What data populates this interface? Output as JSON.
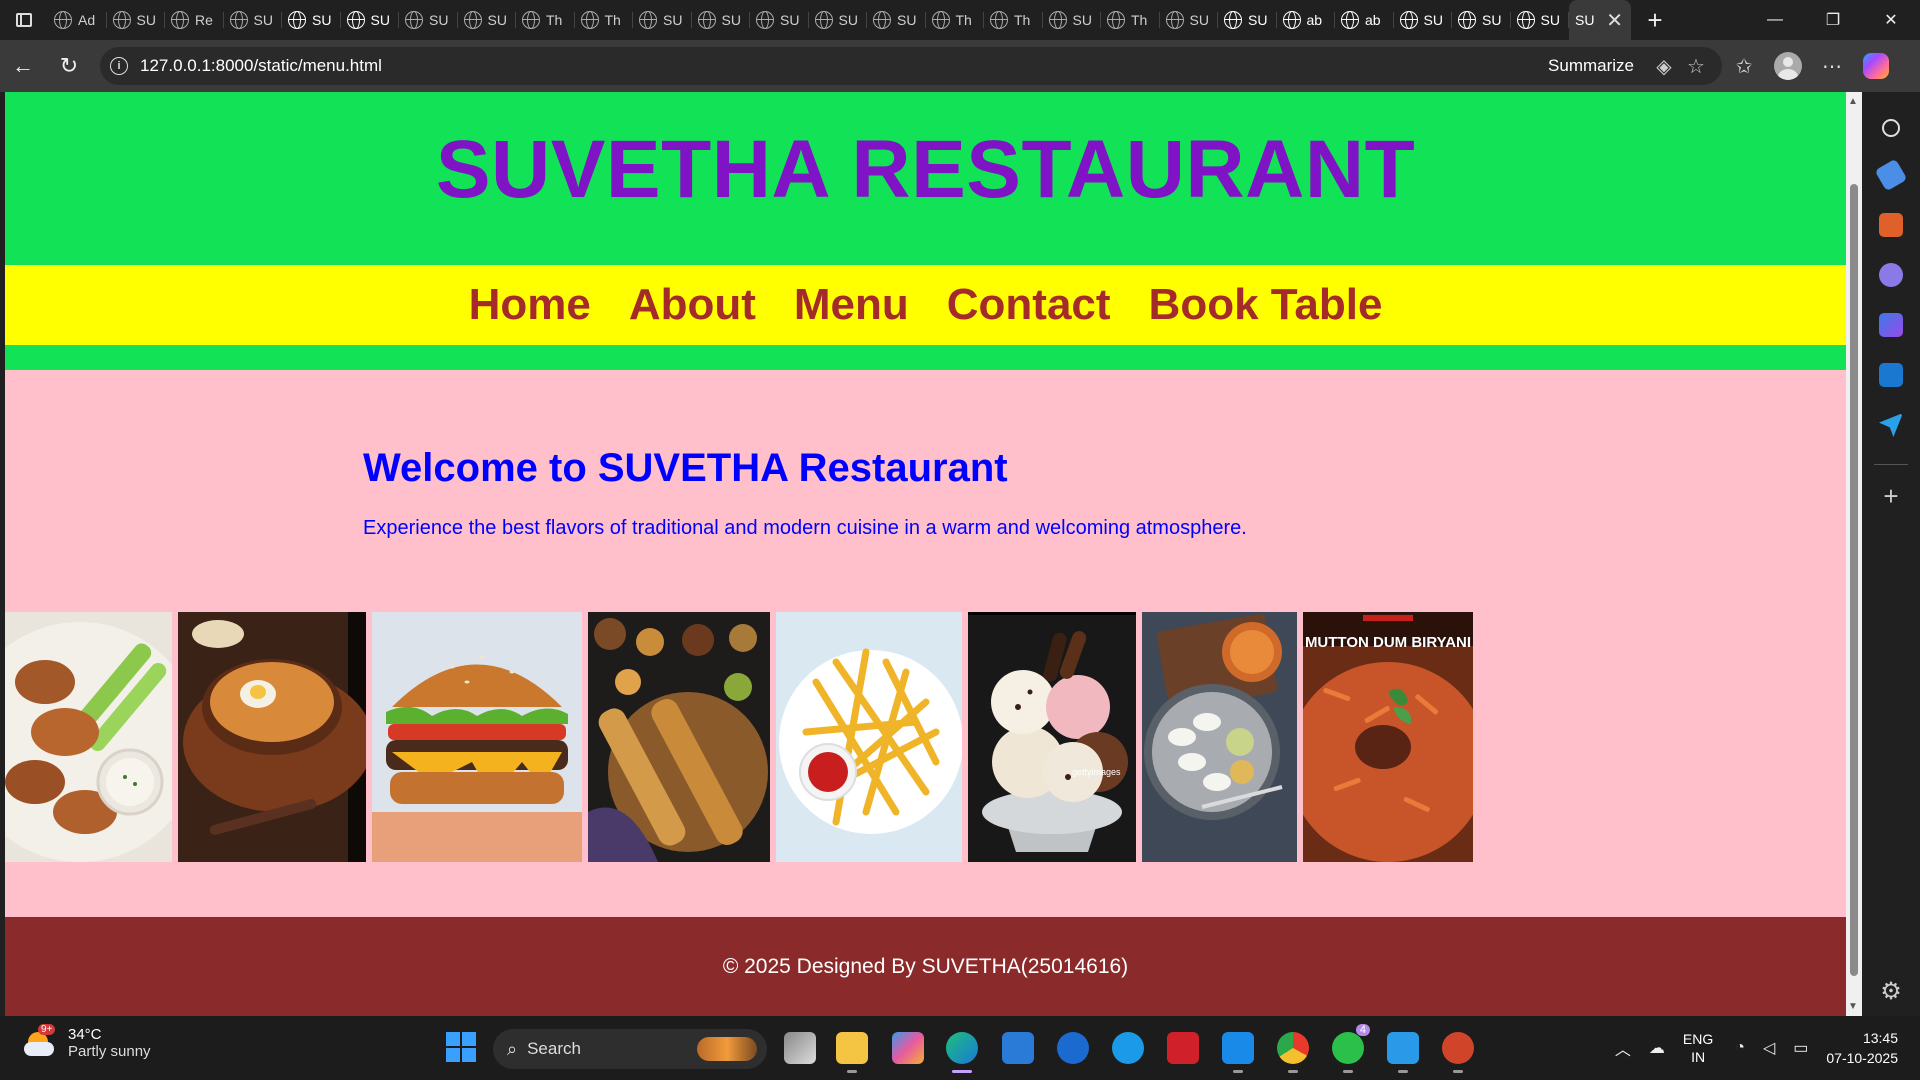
{
  "browser": {
    "tabs": [
      {
        "label": "Ad",
        "style": "dim"
      },
      {
        "label": "SU",
        "style": "dim"
      },
      {
        "label": "Re",
        "style": "dim"
      },
      {
        "label": "SU",
        "style": "dim"
      },
      {
        "label": "SU",
        "style": "bright"
      },
      {
        "label": "SU",
        "style": "bright"
      },
      {
        "label": "SU",
        "style": "dim"
      },
      {
        "label": "SU",
        "style": "dim"
      },
      {
        "label": "Th",
        "style": "dim"
      },
      {
        "label": "Th",
        "style": "dim"
      },
      {
        "label": "SU",
        "style": "dim"
      },
      {
        "label": "SU",
        "style": "dim"
      },
      {
        "label": "SU",
        "style": "dim"
      },
      {
        "label": "SU",
        "style": "dim"
      },
      {
        "label": "SU",
        "style": "dim"
      },
      {
        "label": "Th",
        "style": "dim"
      },
      {
        "label": "Th",
        "style": "dim"
      },
      {
        "label": "SU",
        "style": "dim"
      },
      {
        "label": "Th",
        "style": "dim"
      },
      {
        "label": "SU",
        "style": "dim"
      },
      {
        "label": "SU",
        "style": "bright"
      },
      {
        "label": "ab",
        "style": "bright"
      },
      {
        "label": "ab",
        "style": "bright"
      },
      {
        "label": "SU",
        "style": "bright"
      },
      {
        "label": "SU",
        "style": "bright"
      },
      {
        "label": "SU",
        "style": "bright"
      }
    ],
    "active_tab": {
      "label": "SU"
    },
    "url": "127.0.0.1:8000/static/menu.html",
    "summarize_label": "Summarize"
  },
  "site": {
    "title": "SUVETHA RESTAURANT",
    "nav": [
      {
        "label": "Home"
      },
      {
        "label": "About"
      },
      {
        "label": "Menu"
      },
      {
        "label": "Contact"
      },
      {
        "label": "Book Table"
      }
    ],
    "welcome_heading": "Welcome to SUVETHA Restaurant",
    "welcome_text": "Experience the best flavors of traditional and modern cuisine in a warm and welcoming atmosphere.",
    "gallery": [
      {
        "name": "chicken-wings"
      },
      {
        "name": "biryani-pot"
      },
      {
        "name": "burger"
      },
      {
        "name": "dosa"
      },
      {
        "name": "french-fries"
      },
      {
        "name": "ice-cream",
        "watermark": "gettyimages"
      },
      {
        "name": "idli"
      },
      {
        "name": "mutton-biryani",
        "caption": "MUTTON DUM BIRYANI"
      }
    ],
    "footer": "© 2025 Designed By SUVETHA(25014616)",
    "colors": {
      "header_bg": "#12e255",
      "title": "#7f13c5",
      "nav_bg": "#ffff00",
      "nav_text": "#a52a2a",
      "body_bg": "#ffc0cb",
      "welcome_text": "#0000ff",
      "footer_bg": "#8b2a2a"
    }
  },
  "taskbar": {
    "weather_temp": "34°C",
    "weather_desc": "Partly sunny",
    "weather_badge": "9+",
    "search_label": "Search",
    "whatsapp_badge": "4",
    "lang_line1": "ENG",
    "lang_line2": "IN",
    "time": "13:45",
    "date": "07-10-2025"
  }
}
